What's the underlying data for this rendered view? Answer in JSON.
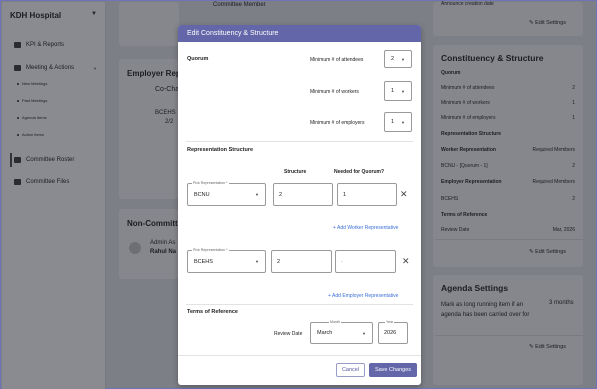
{
  "colors": {
    "accent": "#6366a8",
    "link": "#3b6fd6",
    "overlay": "#7d7f86"
  },
  "sidebar": {
    "org": "KDH Hospital",
    "items": [
      {
        "label": "KPI & Reports",
        "icon": "chart-icon"
      },
      {
        "label": "Meeting & Actions",
        "icon": "calendar-icon"
      },
      {
        "label": "Committee Roster",
        "icon": "people-icon"
      },
      {
        "label": "Committee Files",
        "icon": "folder-icon"
      }
    ],
    "subitems": [
      "New Meetings",
      "Past Meetings",
      "Agenda Items",
      "Action Items"
    ]
  },
  "middle": {
    "top_text": "Committee Member",
    "employer_heading": "Employer Repr",
    "co_chair": "Co-Chai",
    "bceh_a": "BCEHS",
    "bceh_b": "2/2",
    "non_committee": "Non-Committ",
    "admin": "Admin As",
    "rahul": "Rahul Na"
  },
  "right": {
    "top_text": "Announce creation date",
    "edit_settings": "Edit Settings",
    "title": "Constituency & Structure",
    "quorum_heading": "Quorum",
    "quorum_rows": [
      {
        "label": "Minimum # of attendees",
        "value": "2"
      },
      {
        "label": "Minimum # of workers",
        "value": "1"
      },
      {
        "label": "Minimum # of employers",
        "value": "1"
      }
    ],
    "rep_heading": "Representation Structure",
    "worker_label": "Worker Representation",
    "worker_req": "Required Members",
    "worker_row": {
      "label": "BCNU - [Quorum - 1]",
      "value": "2"
    },
    "employer_label": "Employer Representation",
    "employer_req": "Required Members",
    "employer_row": {
      "label": "BCEHS",
      "value": "2"
    },
    "tor_heading": "Terms of Reference",
    "review_label": "Review Date",
    "review_value": "Mar, 2026",
    "agenda_title": "Agenda Settings",
    "agenda_text": "Mark as long running item if an agenda has been carried over for",
    "agenda_value": "3 months"
  },
  "modal": {
    "title": "Edit Constituency & Structure",
    "quorum_label": "Quorum",
    "min_attendees_label": "Minimum # of attendees",
    "min_attendees": "2",
    "min_workers_label": "Minimum # of workers",
    "min_workers": "1",
    "min_employers_label": "Minimum # of employers",
    "min_employers": "1",
    "rep_heading": "Representation Structure",
    "col_structure": "Structure",
    "col_needed": "Needed for Quorum?",
    "pick_rep_label": "Pick Representation *",
    "worker_rep": "BCNU",
    "worker_structure": "2",
    "worker_needed": "1",
    "add_worker": "+ Add Worker Representative",
    "employer_rep": "BCEHS",
    "employer_structure": "2",
    "employer_needed": "-",
    "add_employer": "+ Add Employer Representative",
    "tor_heading": "Terms of Reference",
    "review_date_label": "Review Date",
    "month_label": "Month",
    "month": "March",
    "year_label": "Year",
    "year": "2026",
    "cancel": "Cancel",
    "save": "Save Changes"
  }
}
